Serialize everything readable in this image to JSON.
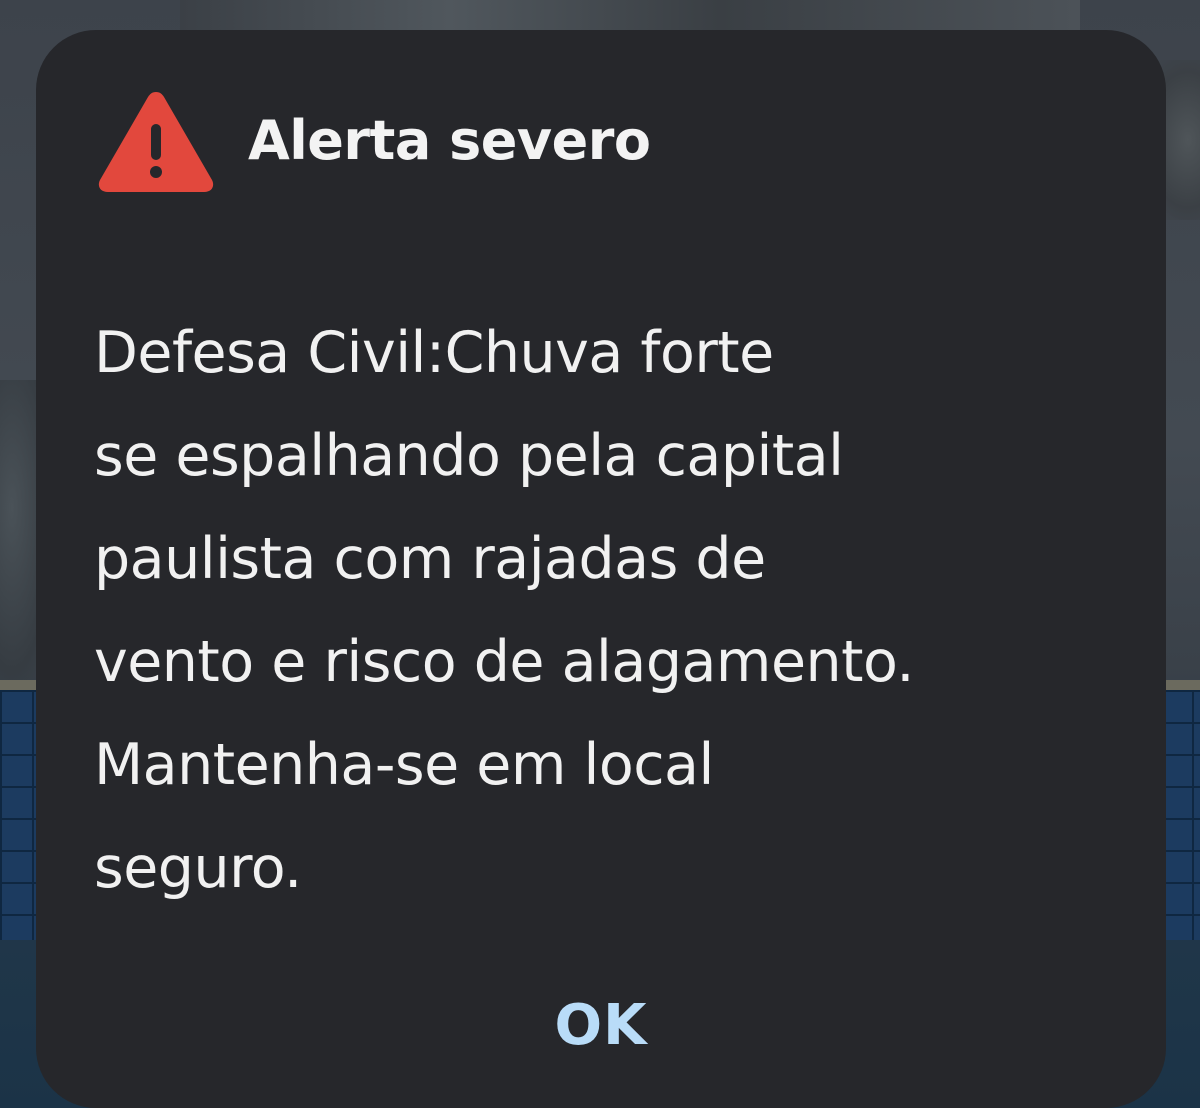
{
  "dialog": {
    "title": "Alerta severo",
    "icon": "warning-triangle-icon",
    "message_lines": [
      "Defesa Civil:Chuva forte",
      "se espalhando pela capital",
      "paulista com rajadas de",
      "vento e risco de alagamento.",
      "Mantenha-se em local",
      "seguro."
    ],
    "ok_label": "OK"
  },
  "colors": {
    "dialog_background": "#26272b",
    "warning_red": "#e2483d",
    "text": "#f1f1f1",
    "button_text": "#b9dcf8"
  }
}
